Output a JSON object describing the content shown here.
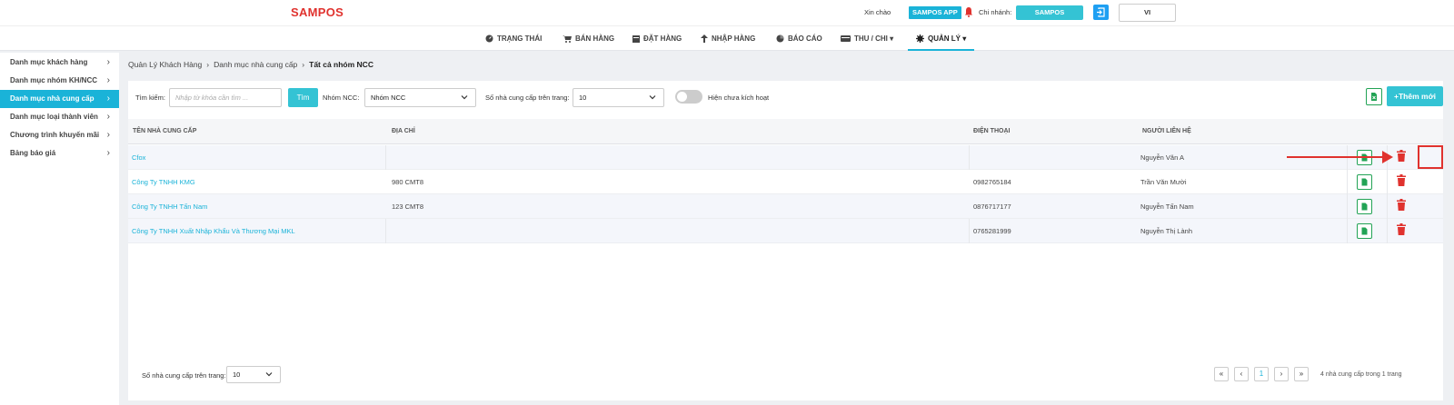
{
  "header": {
    "logo": "SAMPOS",
    "greeting": "Xin chào",
    "app_badge": "SAMPOS APP",
    "branch_label": "Chi nhánh:",
    "branch_value": "SAMPOS",
    "language": "VI"
  },
  "nav": {
    "items": [
      {
        "label": "TRẠNG THÁI",
        "icon": "dashboard-icon"
      },
      {
        "label": "BÁN HÀNG",
        "icon": "cart-icon"
      },
      {
        "label": "ĐẶT HÀNG",
        "icon": "calendar-icon"
      },
      {
        "label": "NHẬP HÀNG",
        "icon": "arrow-up-icon"
      },
      {
        "label": "BÁO CÁO",
        "icon": "pie-chart-icon"
      },
      {
        "label": "THU / CHI",
        "icon": "bank-icon"
      },
      {
        "label": "QUẢN LÝ",
        "icon": "gear-icon"
      }
    ],
    "active": "QUẢN LÝ"
  },
  "sidebar": {
    "items": [
      {
        "label": "Danh mục khách hàng"
      },
      {
        "label": "Danh mục nhóm KH/NCC"
      },
      {
        "label": "Danh mục nhà cung cấp"
      },
      {
        "label": "Danh mục loại thành viên"
      },
      {
        "label": "Chương trình khuyến mãi"
      },
      {
        "label": "Bảng báo giá"
      }
    ],
    "active": "Danh mục nhà cung cấp"
  },
  "breadcrumb": {
    "items": [
      "Quản Lý Khách Hàng",
      "Danh mục nhà cung cấp"
    ],
    "current": "Tất cả nhóm NCC"
  },
  "filters": {
    "search_label": "Tìm kiếm:",
    "search_placeholder": "Nhập từ khóa cần tìm ...",
    "search_button": "Tìm",
    "group_label": "Nhóm NCC:",
    "group_value": "Nhóm NCC",
    "per_page_label": "Số nhà cung cấp trên trang:",
    "per_page_value": "10",
    "toggle_label": "Hiện chưa kích hoạt",
    "add_button": "+Thêm mới"
  },
  "table": {
    "columns": [
      "TÊN NHÀ CUNG CẤP",
      "ĐỊA CHỈ",
      "ĐIỆN THOẠI",
      "NGƯỜI LIÊN HỆ"
    ],
    "rows": [
      {
        "name": "Cfox",
        "address": "",
        "phone": "",
        "contact": "Nguyễn Văn A"
      },
      {
        "name": "Công Ty TNHH KMG",
        "address": "980 CMT8",
        "phone": "0982765184",
        "contact": "Trần Văn Mười"
      },
      {
        "name": "Công Ty TNHH Tấn Nam",
        "address": "123 CMT8",
        "phone": "0876717177",
        "contact": "Nguyễn Tấn Nam"
      },
      {
        "name": "Công Ty TNHH Xuất Nhập Khẩu Và Thương Mại MKL",
        "address": "",
        "phone": "0765281999",
        "contact": "Nguyễn Thị Lành"
      }
    ]
  },
  "footer": {
    "per_page_label": "Số nhà cung cấp trên trang:",
    "per_page_value": "10",
    "current_page": "1",
    "summary": "4 nhà cung cấp trong 1 trang"
  },
  "colors": {
    "accent": "#1ab3d8",
    "button": "#34c3d4",
    "danger": "#e0322e",
    "excel": "#22a355"
  }
}
